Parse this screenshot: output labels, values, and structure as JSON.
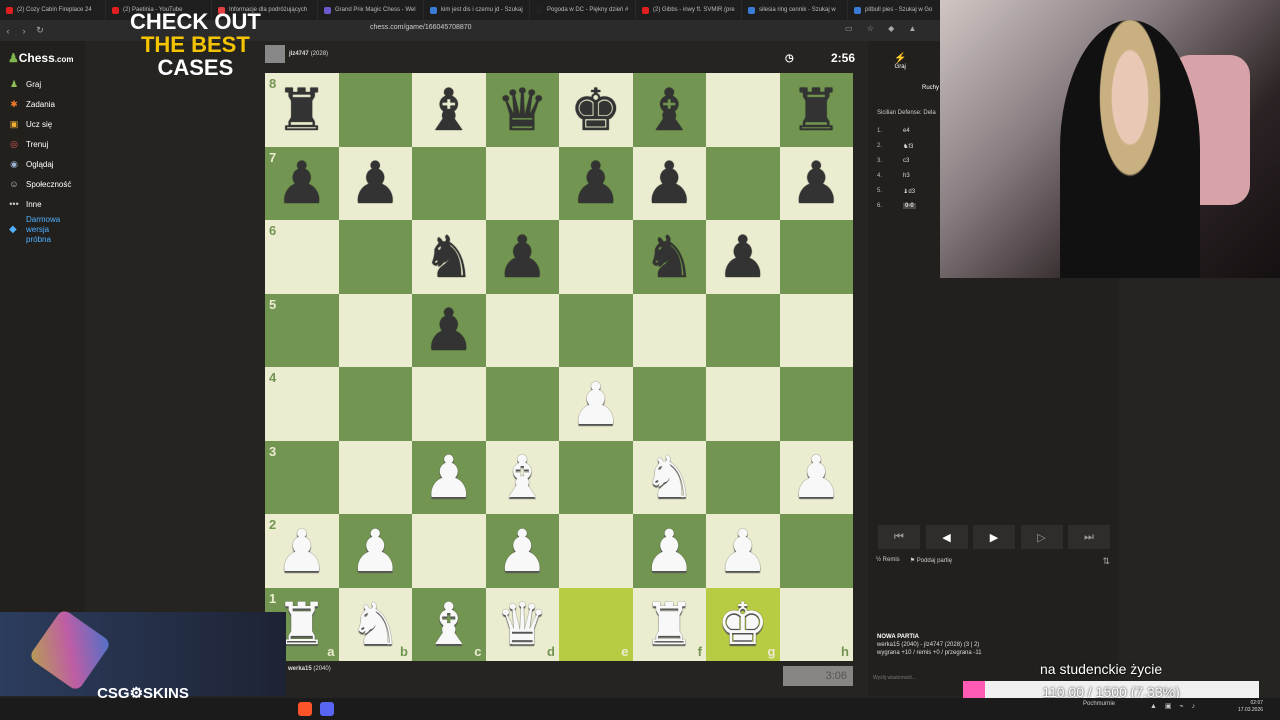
{
  "browser": {
    "tabs": [
      {
        "label": "(2) Cozy Cabin Fireplace 24",
        "color": "#e02020"
      },
      {
        "label": "(2) Paetinia - YouTube",
        "color": "#e02020"
      },
      {
        "label": "Informacje dla podróżujących",
        "color": "#e04040"
      },
      {
        "label": "Grand Prix Magic Chess - Wel",
        "color": "#6a5acd"
      },
      {
        "label": "kim jest dis i czemu jd - Szukaj",
        "color": "#3a7bd5"
      },
      {
        "label": "Pogoda w DC - Piękny dzień #",
        "color": "#222222"
      },
      {
        "label": "(2) Gibbs - inwy ft. SVMIR (pre",
        "color": "#e02020"
      },
      {
        "label": "silesia ring cennik - Szukaj w",
        "color": "#3a7bd5"
      },
      {
        "label": "pitbull pies - Szukaj w Go",
        "color": "#3a7bd5"
      }
    ],
    "url": "chess.com/game/166045708870"
  },
  "sidebar": {
    "logo": "Chess",
    "logo_suffix": ".com",
    "items": [
      {
        "label": "Graj",
        "icon": "♟"
      },
      {
        "label": "Zadania",
        "icon": "✱"
      },
      {
        "label": "Ucz się",
        "icon": "▣"
      },
      {
        "label": "Trenuj",
        "icon": "◎"
      },
      {
        "label": "Oglądaj",
        "icon": "◉"
      },
      {
        "label": "Społeczność",
        "icon": "☺"
      },
      {
        "label": "Inne",
        "icon": "•••"
      }
    ],
    "trial": "Darmowa wersja próbna"
  },
  "players": {
    "top": {
      "name": "jlz4747",
      "rating": "(2028)",
      "clock": "2:56"
    },
    "bottom": {
      "name": "werka15",
      "rating": "(2040)",
      "clock": "3:06"
    }
  },
  "board": {
    "ranks": [
      "8",
      "7",
      "6",
      "5",
      "4",
      "3",
      "2",
      "1"
    ],
    "files": [
      "a",
      "b",
      "c",
      "d",
      "e",
      "f",
      "g",
      "h"
    ],
    "rows": [
      [
        "br",
        "",
        "bb",
        "bq",
        "bk",
        "bb",
        "",
        "br"
      ],
      [
        "bp",
        "bp",
        "",
        "",
        "bp",
        "bp",
        "",
        "bp"
      ],
      [
        "",
        "",
        "bn",
        "bp",
        "",
        "bn",
        "bp",
        ""
      ],
      [
        "",
        "",
        "bp",
        "",
        "",
        "",
        "",
        ""
      ],
      [
        "",
        "",
        "",
        "",
        "wp",
        "",
        "",
        ""
      ],
      [
        "",
        "",
        "wp",
        "wb",
        "",
        "wn",
        "",
        "wp"
      ],
      [
        "wp",
        "wp",
        "",
        "wp",
        "",
        "wp",
        "wp",
        ""
      ],
      [
        "wr",
        "wn",
        "wb",
        "wq",
        "",
        "wr",
        "wk",
        ""
      ]
    ],
    "highlight": [
      "e1",
      "g1"
    ]
  },
  "right_panel": {
    "tab_play": "Graj",
    "tab_moves": "Ruchy",
    "opening": "Sicilian Defense: Dela",
    "moves": [
      {
        "num": "1.",
        "move": "e4"
      },
      {
        "num": "2.",
        "move": "♞f3"
      },
      {
        "num": "3.",
        "move": "c3"
      },
      {
        "num": "4.",
        "move": "h3"
      },
      {
        "num": "5.",
        "move": "♝d3"
      },
      {
        "num": "6.",
        "move": "0-0"
      }
    ],
    "draw": "Remis",
    "resign": "Poddaj partię",
    "new_game_title": "NOWA PARTIA",
    "new_game_players": "werka15 (2040) - jlz4747 (2028) (3 | 2)",
    "new_game_stakes": "wygrana +10 / remis +0 / przegrana -11",
    "chat_placeholder": "Wyślij wiadomość..."
  },
  "ad": {
    "line1": "CHECK OUT",
    "line2": "THE BEST",
    "line3": "CASES",
    "brand": "CSG⚙SKINS"
  },
  "goal": {
    "title": "na studenckie życie",
    "text": "110.00 / 1500 (7.33%)",
    "progress": 0.0733
  },
  "taskbar": {
    "weather": "Pochmurnie",
    "time": "02:07",
    "date": "17.03.2026"
  }
}
